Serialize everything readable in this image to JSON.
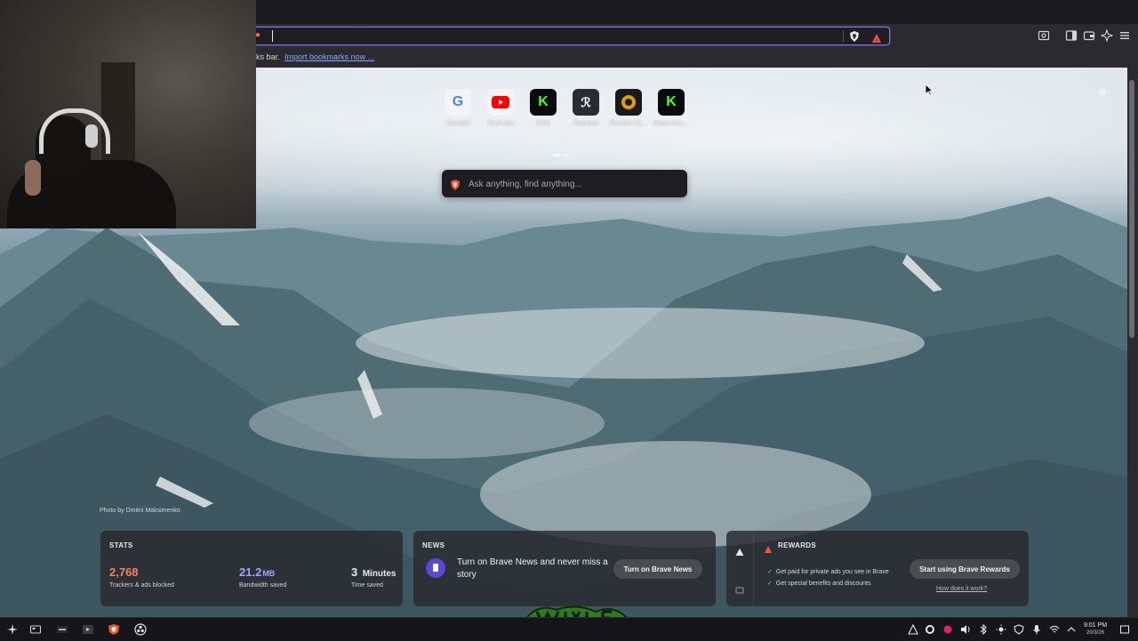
{
  "toolbar": {
    "address_value": "",
    "colors": {
      "omnibox_focus": "#7d6ff0",
      "brave_orange": "#fb542b"
    }
  },
  "bookmarks_bar": {
    "prefix_text": "ks bar.",
    "import_link": "Import bookmarks now ..."
  },
  "top_sites": [
    {
      "label": "Google",
      "icon": "google-icon"
    },
    {
      "label": "YouTube",
      "icon": "youtube-icon"
    },
    {
      "label": "Kick",
      "icon": "kick-icon"
    },
    {
      "label": "Rainbet",
      "icon": "rainbet-icon"
    },
    {
      "label": "Roobet Cr...",
      "icon": "roobet-icon"
    },
    {
      "label": "https://kic...",
      "icon": "kick-icon"
    }
  ],
  "search": {
    "placeholder": "Ask anything, find anything..."
  },
  "photo_credit": "Photo by Dmitrii Maksimenko",
  "stats": {
    "title": "STATS",
    "trackers": {
      "value": "2,768",
      "caption": "Trackers & ads blocked",
      "color": "#ff7f5c"
    },
    "bandwidth": {
      "value": "21.2",
      "unit": "MB",
      "caption": "Bandwidth saved",
      "color": "#a7a2ff"
    },
    "time": {
      "value": "3",
      "unit": "Minutes",
      "caption": "Time saved"
    }
  },
  "news": {
    "title": "NEWS",
    "text": "Turn on Brave News and never miss a story",
    "button": "Turn on Brave News"
  },
  "rewards": {
    "title": "REWARDS",
    "items": [
      "Get paid for private ads you see in Brave",
      "Get special benefits and discounts"
    ],
    "button": "Start using Brave Rewards",
    "link": "How does it work?"
  },
  "taskbar": {
    "clock_time": "9:01 PM",
    "clock_date": "20/3/26"
  }
}
